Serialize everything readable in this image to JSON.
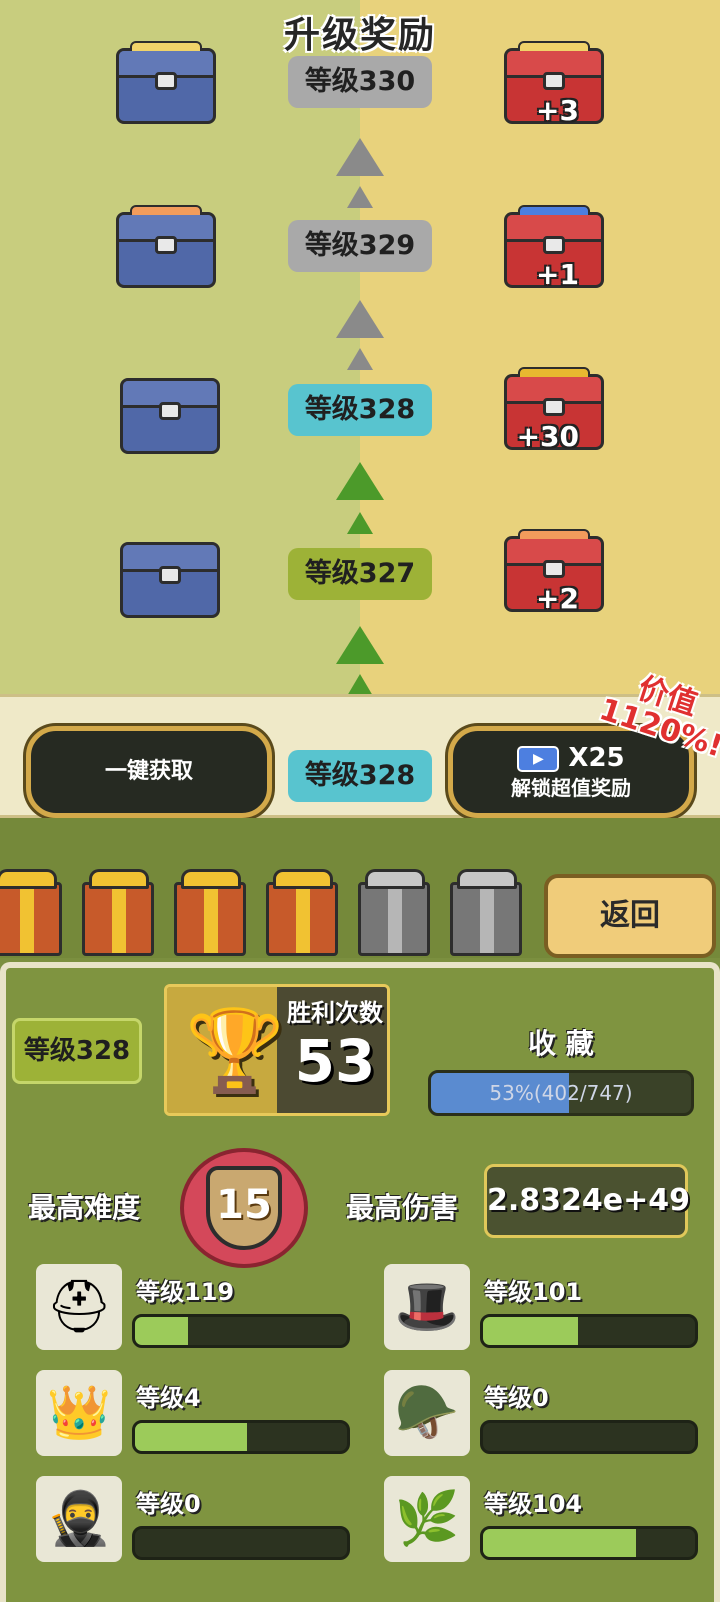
{
  "track": {
    "title": "升级奖励",
    "rows": [
      {
        "level": "等级330",
        "state": "locked",
        "free_reward": "ticket-chest",
        "paid_reward": "ticket-chest",
        "paid_count": "+3"
      },
      {
        "level": "等级329",
        "state": "locked",
        "free_reward": "shard-chest",
        "paid_reward": "video-ticket-chest",
        "paid_count": "+1"
      },
      {
        "level": "等级328",
        "state": "current",
        "free_reward": "empty-chest",
        "paid_reward": "coin-chest",
        "paid_count": "+30"
      },
      {
        "level": "等级327",
        "state": "reached",
        "free_reward": "empty-chest",
        "paid_reward": "shard-chest",
        "paid_count": "+2"
      }
    ]
  },
  "action_bar": {
    "claim_all_label": "一键获取",
    "current_level": "等级328",
    "unlock_multiplier": "X25",
    "unlock_label": "解锁超值奖励",
    "value_badge_line1": "价值",
    "value_badge_line2": "1120%!"
  },
  "gifts": {
    "boxes": [
      "opened",
      "opened",
      "opened",
      "opened",
      "locked",
      "locked"
    ],
    "back_label": "返回"
  },
  "stats": {
    "level": "等级328",
    "wins_label": "胜利次数",
    "wins_value": "53",
    "collection_label": "收 藏",
    "collection_text": "53%(402/747)",
    "collection_fraction": 0.53,
    "max_difficulty_label": "最高难度",
    "max_difficulty_value": "15",
    "max_damage_label": "最高伤害",
    "max_damage_value": "2.8324e+49"
  },
  "equipment": [
    {
      "icon": "helmet-icon",
      "glyph": "⛑",
      "level": "等级119",
      "fraction": 0.25
    },
    {
      "icon": "wizard-hat-icon",
      "glyph": "🎩",
      "level": "等级101",
      "fraction": 0.45
    },
    {
      "icon": "crown-icon",
      "glyph": "👑",
      "level": "等级4",
      "fraction": 0.53
    },
    {
      "icon": "leather-cap-icon",
      "glyph": "🪖",
      "level": "等级0",
      "fraction": 0.0
    },
    {
      "icon": "hood-icon",
      "glyph": "🥷",
      "level": "等级0",
      "fraction": 0.0
    },
    {
      "icon": "leaf-hood-icon",
      "glyph": "🌿",
      "level": "等级104",
      "fraction": 0.72
    }
  ],
  "colors": {
    "track_left": "#c8cd7e",
    "track_right": "#e8d27c",
    "pill_locked": "#a9a9a9",
    "pill_current": "#58c4cf",
    "pill_reached": "#9db237",
    "panel": "#7f9440",
    "progress_green": "#9ccb5a",
    "collection_blue": "#5a8bd0"
  }
}
